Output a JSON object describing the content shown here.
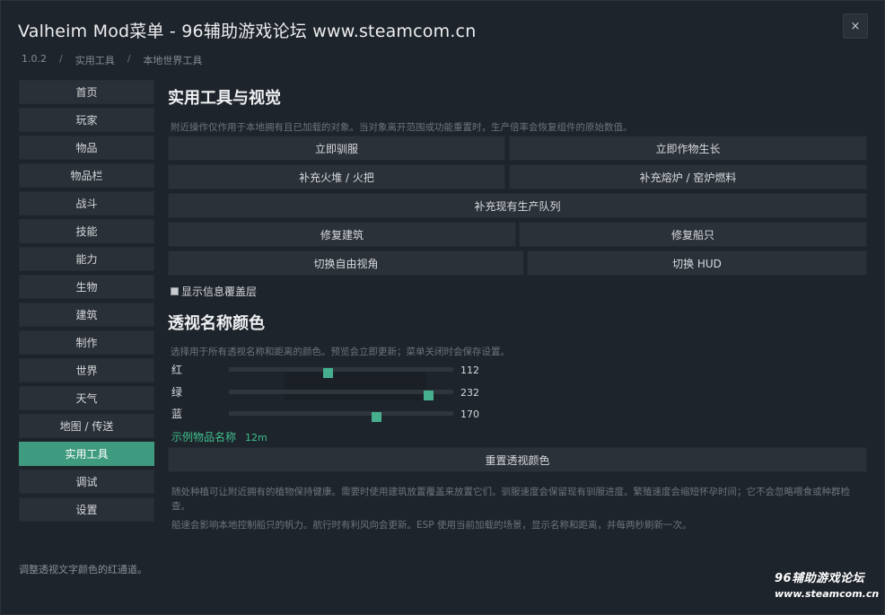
{
  "window": {
    "title": "Valheim Mod菜单 - 96辅助游戏论坛 www.steamcom.cn",
    "close_label": "×"
  },
  "breadcrumb": [
    "1.0.2",
    "实用工具",
    "本地世界工具"
  ],
  "sidebar": {
    "items": [
      {
        "label": "首页"
      },
      {
        "label": "玩家"
      },
      {
        "label": "物品"
      },
      {
        "label": "物品栏"
      },
      {
        "label": "战斗"
      },
      {
        "label": "技能"
      },
      {
        "label": "能力"
      },
      {
        "label": "生物"
      },
      {
        "label": "建筑"
      },
      {
        "label": "制作"
      },
      {
        "label": "世界"
      },
      {
        "label": "天气"
      },
      {
        "label": "地图 / 传送"
      },
      {
        "label": "实用工具",
        "active": true
      },
      {
        "label": "调试"
      },
      {
        "label": "设置"
      }
    ]
  },
  "tools": {
    "heading": "实用工具与视觉",
    "description": "附近操作仅作用于本地拥有且已加载的对象。当对象离开范围或功能重置时，生产倍率会恢复组件的原始数值。",
    "buttons": {
      "tame_now": "立即驯服",
      "grow_crops": "立即作物生长",
      "refuel_fire": "补充火堆 / 火把",
      "refuel_smelter": "补充熔炉 / 窑炉燃料",
      "refill_queue": "补充现有生产队列",
      "repair_buildings": "修复建筑",
      "repair_ships": "修复船只",
      "toggle_freecam": "切换自由视角",
      "toggle_hud": "切换 HUD"
    },
    "overlay_checkbox": "显示信息覆盖层"
  },
  "esp": {
    "heading": "透视名称颜色",
    "description": "选择用于所有透视名称和距离的颜色。预览会立即更新；菜单关闭时会保存设置。",
    "red_label": "红",
    "red_value": 112,
    "green_label": "绿",
    "green_value": 232,
    "blue_label": "蓝",
    "blue_value": 170,
    "slider_max": 255,
    "sample_name": "示例物品名称",
    "sample_distance": "12m",
    "sample_color": "#70e8aa",
    "reset_button": "重置透视颜色",
    "note1": "随处种植可让附近拥有的植物保持健康。需要时使用建筑放置覆盖来放置它们。驯服速度会保留现有驯服进度。繁殖速度会缩短怀孕时间；它不会忽略喂食或种群检查。",
    "note2": "船速会影响本地控制船只的帆力。航行时有利风向会更新。ESP 使用当前加载的场景，显示名称和距离，并每两秒刷新一次。"
  },
  "status_bar": "调整透视文字颜色的红通道。",
  "watermark": {
    "line1": "96辅助游戏论坛",
    "line2": "www.steamcom.cn"
  },
  "colors": {
    "accent": "#3e9b7f",
    "knob": "#46b08e",
    "background": "#1e242b"
  }
}
